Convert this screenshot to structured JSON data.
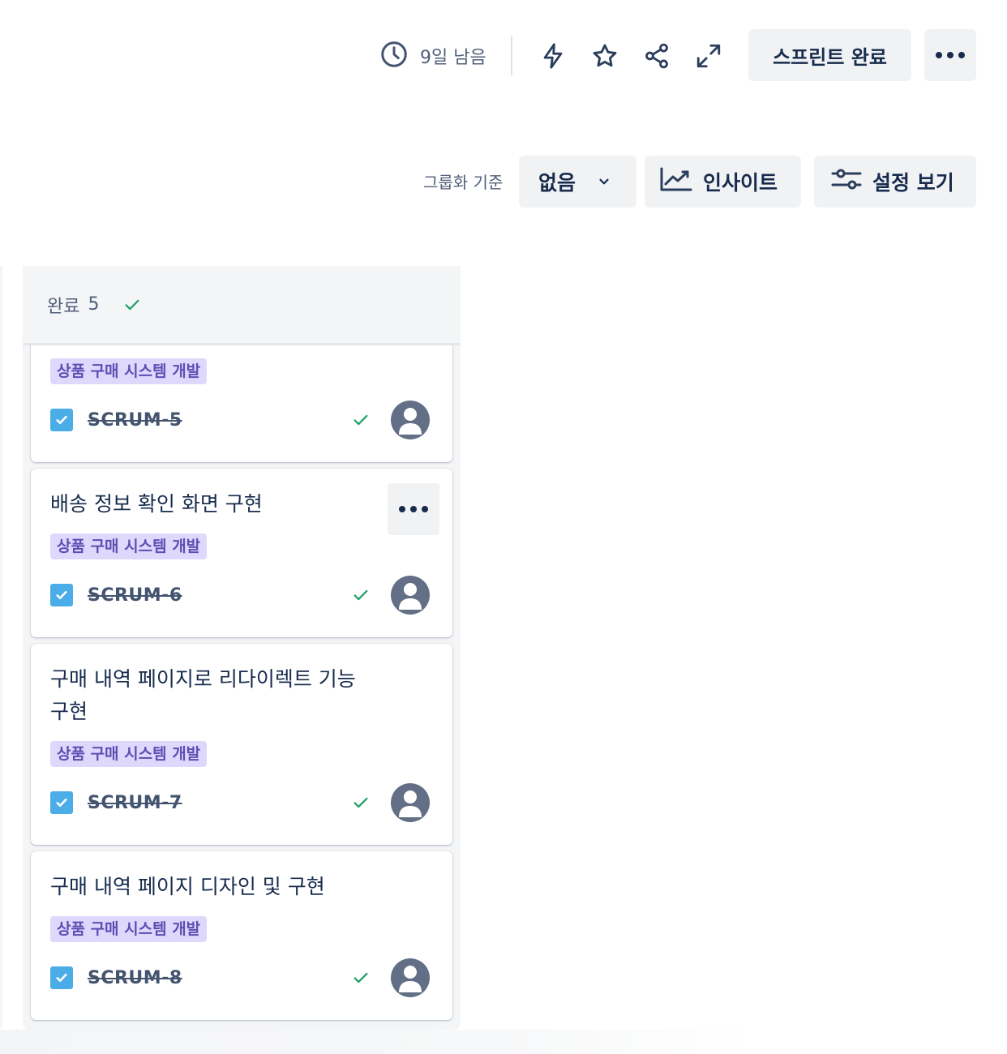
{
  "toolbar": {
    "time_remaining": "9일 남음",
    "complete_sprint_label": "스프린트 완료",
    "icons": [
      "clock-icon",
      "automation-bolt-icon",
      "star-icon",
      "share-icon",
      "fullscreen-icon",
      "more-icon"
    ]
  },
  "filters": {
    "group_by_label": "그룹화 기준",
    "group_by_value": "없음",
    "insight_label": "인사이트",
    "view_settings_label": "설정 보기"
  },
  "column": {
    "title": "완료",
    "count": "5"
  },
  "cards": [
    {
      "title": "",
      "epic": "상품 구매 시스템 개발",
      "key": "SCRUM-5",
      "status": "done"
    },
    {
      "title": "배송 정보 확인 화면 구현",
      "epic": "상품 구매 시스템 개발",
      "key": "SCRUM-6",
      "status": "done"
    },
    {
      "title_line1": "구매 내역 페이지로 리다이렉트 기능",
      "title_line2": "구현",
      "epic": "상품 구매 시스템 개발",
      "key": "SCRUM-7",
      "status": "done"
    },
    {
      "title": "구매 내역 페이지 디자인 및 구현",
      "epic": "상품 구매 시스템 개발",
      "key": "SCRUM-8",
      "status": "done"
    }
  ],
  "colors": {
    "text": "#172B4D",
    "subtle_text": "#505F79",
    "button_bg": "#F1F2F4",
    "column_bg": "#F4F5F7",
    "epic_bg": "#DFD8FD",
    "epic_text": "#5E4DB2",
    "task_icon": "#4BADE8",
    "done_green": "#22A06B",
    "avatar": "#626F86"
  }
}
